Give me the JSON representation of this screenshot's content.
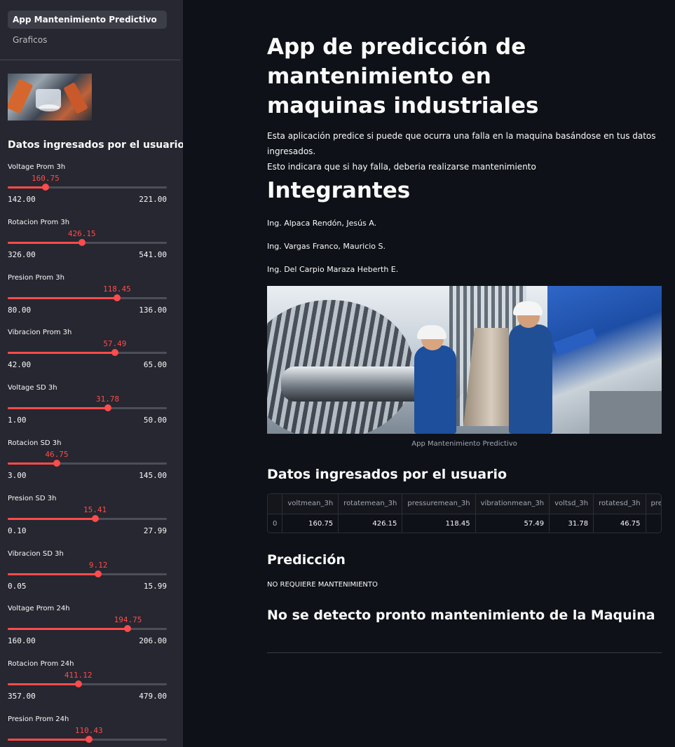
{
  "nav": {
    "items": [
      {
        "label": "App Mantenimiento Predictivo",
        "active": true
      },
      {
        "label": "Graficos",
        "active": false
      }
    ]
  },
  "sidebar": {
    "heading": "Datos ingresados por el usuario",
    "sliders": [
      {
        "label": "Voltage Prom 3h",
        "value": "160.75",
        "min": "142.00",
        "max": "221.00"
      },
      {
        "label": "Rotacion Prom 3h",
        "value": "426.15",
        "min": "326.00",
        "max": "541.00"
      },
      {
        "label": "Presion Prom 3h",
        "value": "118.45",
        "min": "80.00",
        "max": "136.00"
      },
      {
        "label": "Vibracion Prom 3h",
        "value": "57.49",
        "min": "42.00",
        "max": "65.00"
      },
      {
        "label": "Voltage SD 3h",
        "value": "31.78",
        "min": "1.00",
        "max": "50.00"
      },
      {
        "label": "Rotacion SD 3h",
        "value": "46.75",
        "min": "3.00",
        "max": "145.00"
      },
      {
        "label": "Presion SD 3h",
        "value": "15.41",
        "min": "0.10",
        "max": "27.99"
      },
      {
        "label": "Vibracion SD 3h",
        "value": "9.12",
        "min": "0.05",
        "max": "15.99"
      },
      {
        "label": "Voltage Prom 24h",
        "value": "194.75",
        "min": "160.00",
        "max": "206.00"
      },
      {
        "label": "Rotacion Prom 24h",
        "value": "411.12",
        "min": "357.00",
        "max": "479.00"
      },
      {
        "label": "Presion Prom 24h",
        "value": "110.43",
        "min": "",
        "max": ""
      }
    ],
    "accent_color": "#ff4b4b"
  },
  "main": {
    "title": "App de predicción de mantenimiento en maquinas industriales",
    "description_line1": "Esta aplicación predice si puede que ocurra una falla en la maquina basándose en tus datos ingresados.",
    "description_line2": "Esto indicara que si hay falla, deberia realizarse mantenimiento",
    "team_heading": "Integrantes",
    "members": [
      "Ing. Alpaca Rendón, Jesús A.",
      "Ing. Vargas Franco, Mauricio S.",
      "Ing. Del Carpio Maraza Heberth E."
    ],
    "image_caption": "App Mantenimiento Predictivo",
    "data_heading": "Datos ingresados por el usuario",
    "table": {
      "columns": [
        "",
        "voltmean_3h",
        "rotatemean_3h",
        "pressuremean_3h",
        "vibrationmean_3h",
        "voltsd_3h",
        "rotatesd_3h",
        "pressu"
      ],
      "rows": [
        [
          "0",
          "160.75",
          "426.15",
          "118.45",
          "57.49",
          "31.78",
          "46.75",
          ""
        ]
      ]
    },
    "prediction_heading": "Predicción",
    "prediction_text": "NO REQUIERE MANTENIMIENTO",
    "result_heading": "No se detecto pronto mantenimiento de la Maquina"
  }
}
